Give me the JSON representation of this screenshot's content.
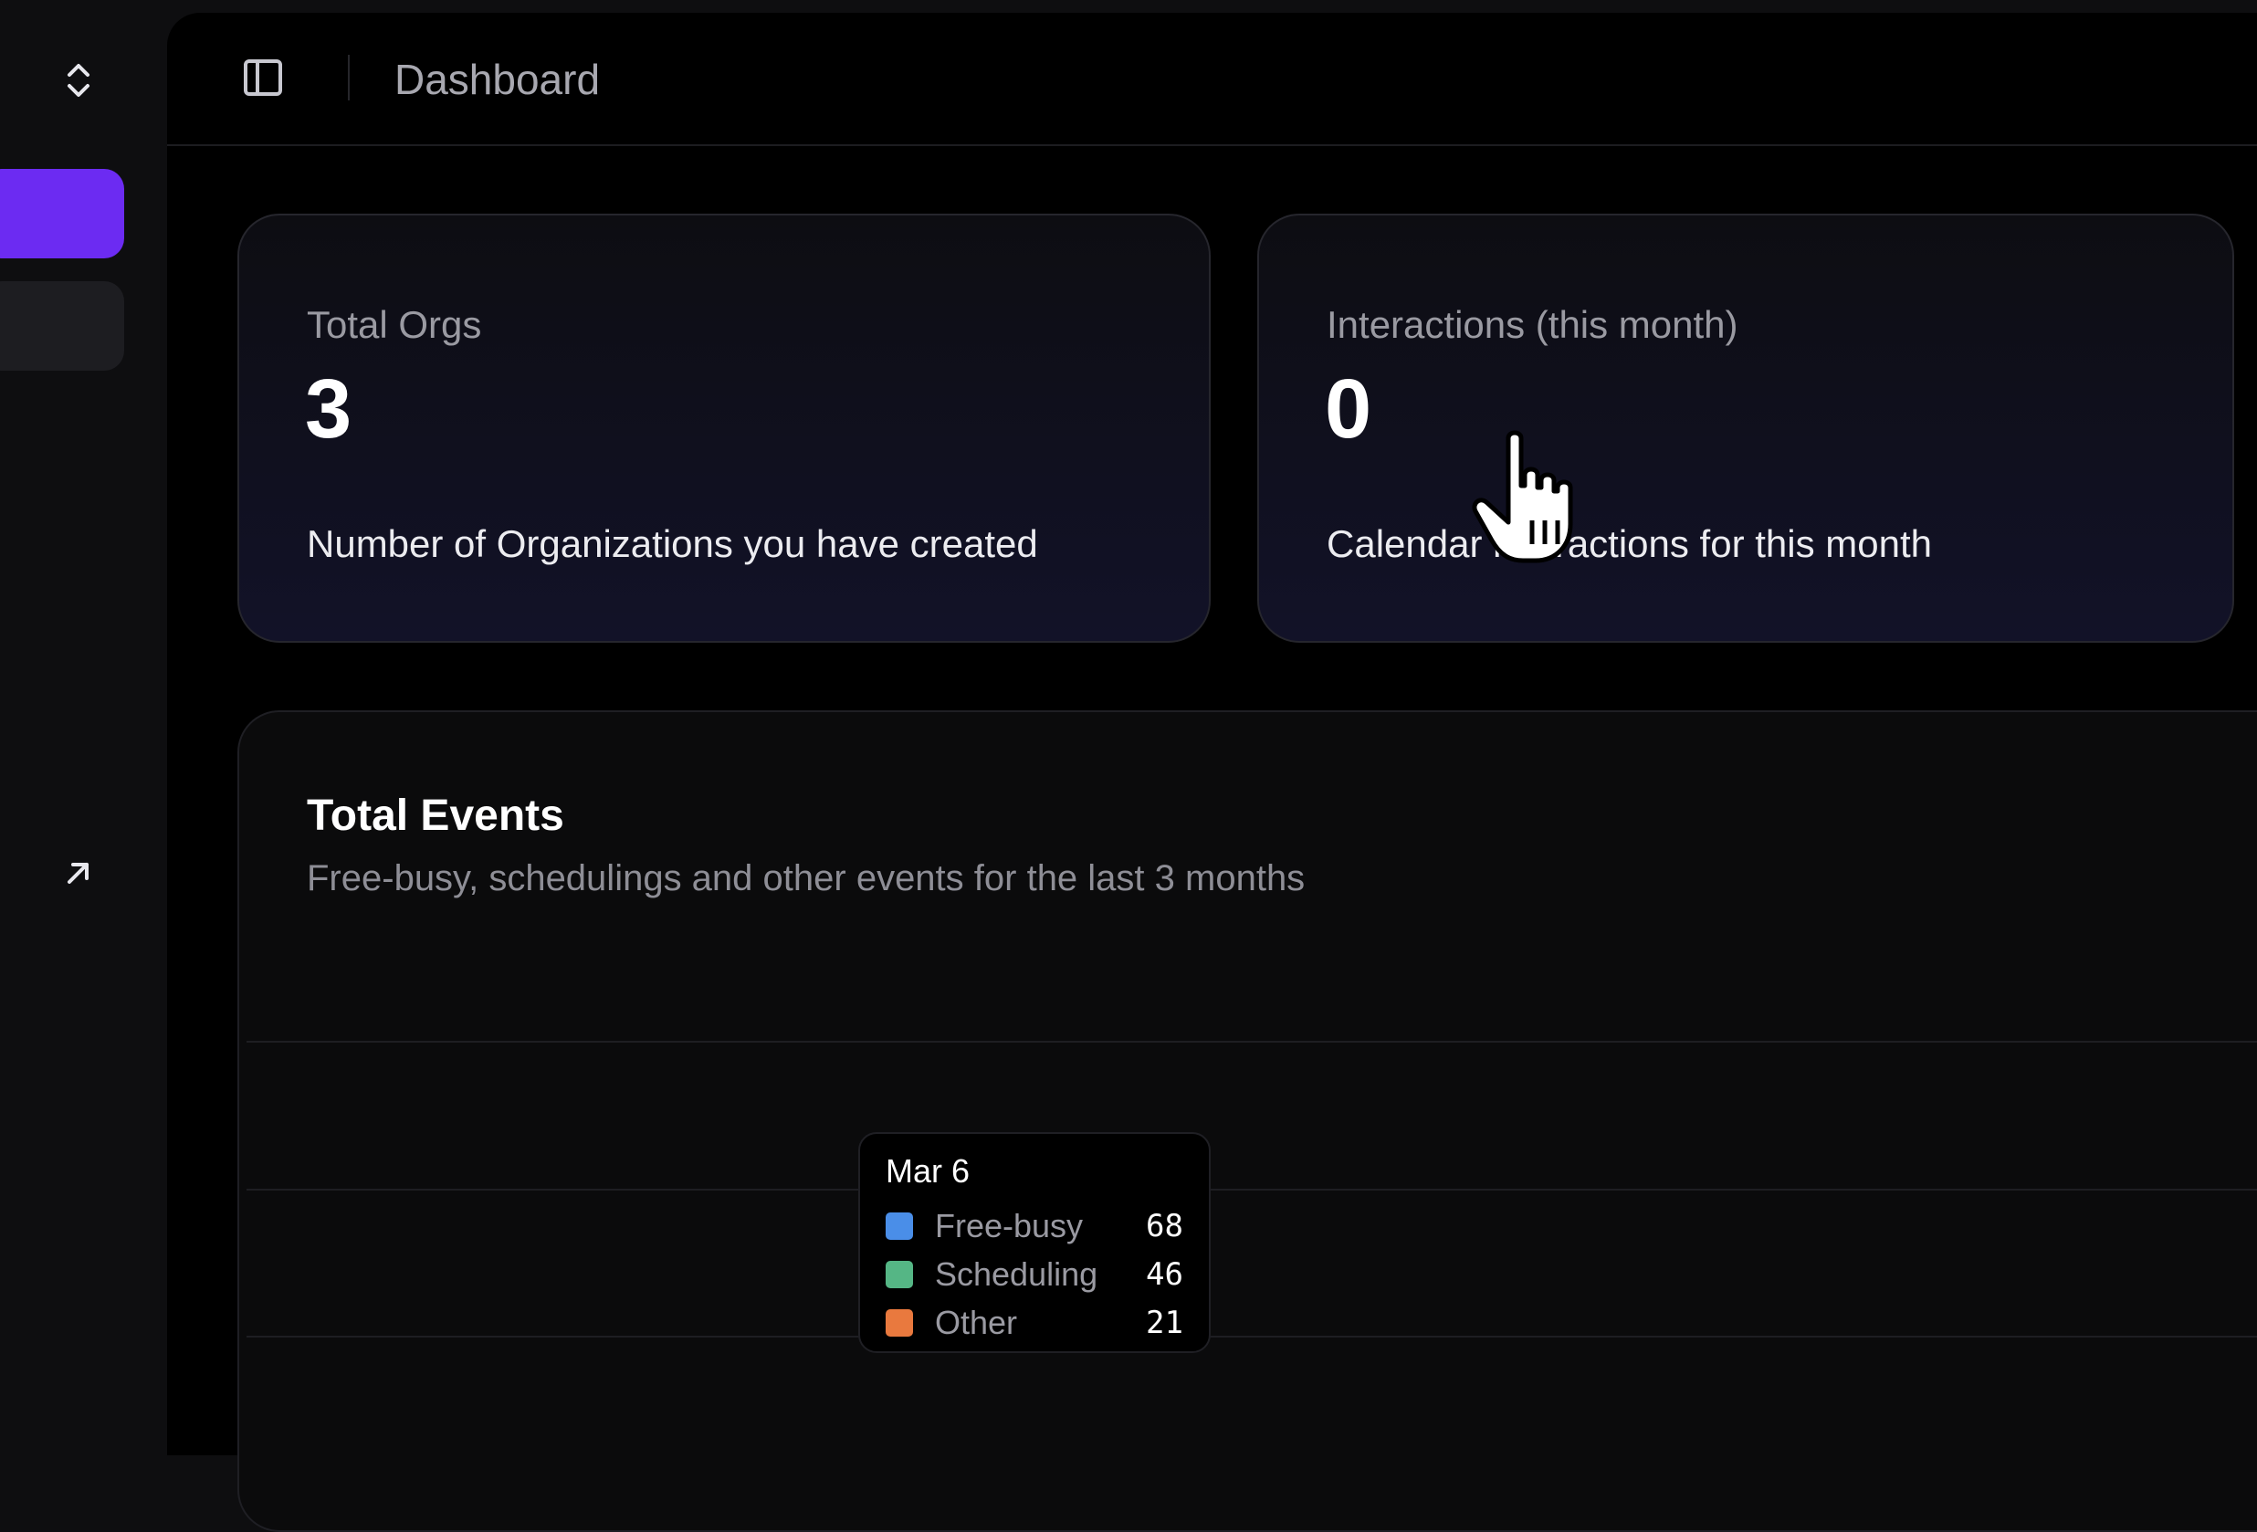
{
  "header": {
    "title": "Dashboard"
  },
  "cards": [
    {
      "label": "Total Orgs",
      "value": "3",
      "description": "Number of Organizations you have created"
    },
    {
      "label": "Interactions (this month)",
      "value": "0",
      "description": "Calendar interactions for this month"
    }
  ],
  "events": {
    "title": "Total Events",
    "subtitle": "Free-busy, schedulings and other events for the last 3 months"
  },
  "tooltip": {
    "date": "Mar 6",
    "items": [
      {
        "name": "Free-busy",
        "value": "68",
        "color": "#4a8ee8"
      },
      {
        "name": "Scheduling",
        "value": "46",
        "color": "#55b685"
      },
      {
        "name": "Other",
        "value": "21",
        "color": "#e9793e"
      }
    ]
  },
  "colors": {
    "accent": "#6c2bf2"
  }
}
